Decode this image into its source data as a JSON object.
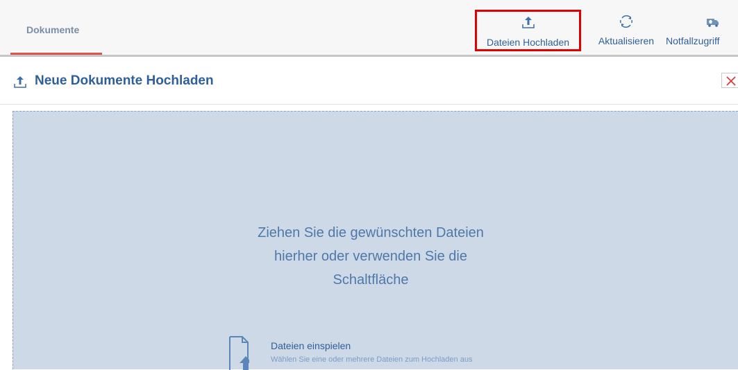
{
  "topbar": {
    "tab_label": "Dokumente",
    "tools": {
      "upload_label": "Dateien Hochladen",
      "refresh_label": "Aktualisieren",
      "emergency_label": "Notfallzugriff"
    }
  },
  "panel": {
    "title": "Neue Dokumente Hochladen"
  },
  "dropzone": {
    "instruction_lines": [
      "Ziehen Sie die gewünschten Dateien",
      "hierher oder verwenden Sie die",
      "Schaltfläche"
    ],
    "import_title": "Dateien einspielen",
    "import_subtitle": "Wählen Sie eine oder mehrere Dateien zum Hochladen aus"
  },
  "colors": {
    "accent_blue": "#2f5f98",
    "tab_underline": "#d9534f",
    "highlight_box": "#e00000",
    "dropzone_bg": "#cdd9e7"
  },
  "icons": {
    "upload": "upload-icon",
    "refresh": "refresh-icon",
    "emergency": "ambulance-icon",
    "close": "close-icon",
    "file": "file-upload-icon"
  }
}
